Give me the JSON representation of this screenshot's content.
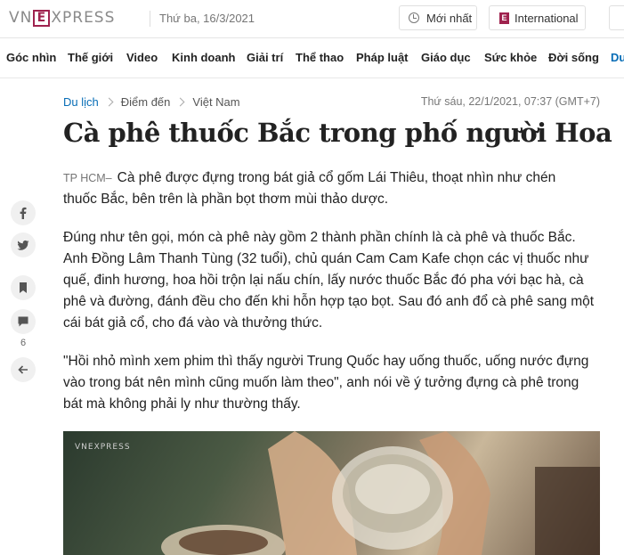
{
  "header": {
    "logo_left": "VN",
    "logo_box": "E",
    "logo_right": "XPRESS",
    "date": "Thứ ba, 16/3/2021",
    "newest_label": "Mới nhất",
    "international_label": "International",
    "international_icon": "E"
  },
  "nav": {
    "items": [
      "Góc nhìn",
      "Thế giới",
      "Video",
      "Kinh doanh",
      "Giải trí",
      "Thể thao",
      "Pháp luật",
      "Giáo dục",
      "Sức khỏe",
      "Đời sống",
      "Du"
    ]
  },
  "article": {
    "breadcrumb": [
      "Du lịch",
      "Điểm đến",
      "Việt Nam"
    ],
    "pubdate": "Thứ sáu, 22/1/2021, 07:37 (GMT+7)",
    "title": "Cà phê thuốc Bắc trong phố người Hoa",
    "location": "TP HCM–",
    "lead": "Cà phê được đựng trong bát giả cổ gốm Lái Thiêu, thoạt nhìn như chén thuốc Bắc, bên trên là phần bọt thơm mùi thảo dược.",
    "paragraph1": "Đúng như tên gọi, món cà phê này gồm 2 thành phần chính là cà phê và thuốc Bắc. Anh Đồng Lâm Thanh Tùng (32 tuổi), chủ quán Cam Cam Kafe chọn các vị thuốc như quế, đinh hương, hoa hồi trộn lại nấu chín, lấy nước thuốc Bắc đó pha với bạc hà, cà phê và đường, đánh đều cho đến khi hỗn hợp tạo bọt. Sau đó anh đổ cà phê sang một cái bát giả cổ, cho đá vào và thưởng thức.",
    "paragraph2": "\"Hồi nhỏ mình xem phim thì thấy người Trung Quốc hay uống thuốc, uống nước đựng vào trong bát nên mình cũng muốn làm theo\", anh nói về ý tưởng đựng cà phê trong bát mà không phải ly như thường thấy.",
    "photo_watermark": "VNEXPRESS"
  },
  "social": {
    "comment_count": "6",
    "icons": [
      "facebook-icon",
      "twitter-icon",
      "bookmark-icon",
      "comment-icon",
      "back-arrow-icon"
    ]
  },
  "colors": {
    "brand": "#9f224e",
    "link": "#076db6"
  }
}
